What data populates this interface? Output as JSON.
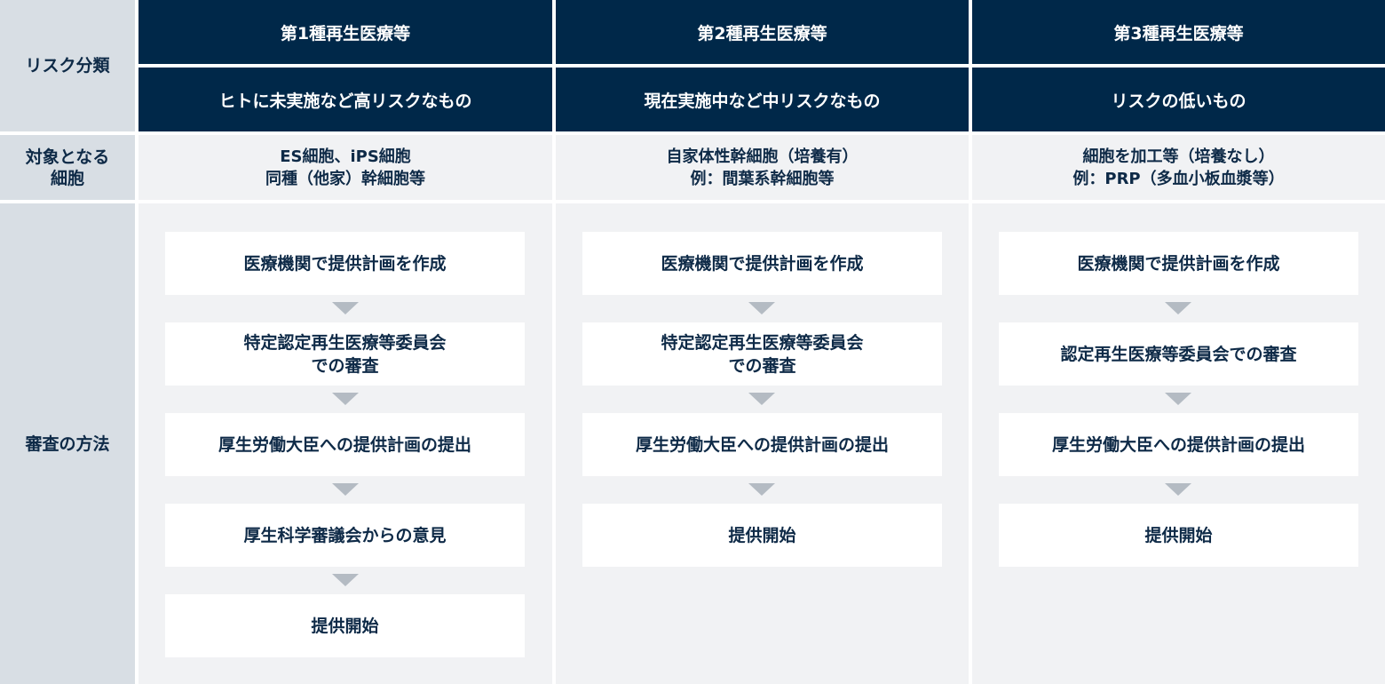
{
  "row_headers": {
    "risk": "リスク分類",
    "cells": "対象となる\n細胞",
    "review": "審査の方法"
  },
  "columns": [
    {
      "title": "第1種再生医療等",
      "risk_desc": "ヒトに未実施など高リスクなもの",
      "target_cells": "ES細胞、iPS細胞\n同種（他家）幹細胞等",
      "steps": [
        "医療機関で提供計画を作成",
        "特定認定再生医療等委員会\nでの審査",
        "厚生労働大臣への提供計画の提出",
        "厚生科学審議会からの意見",
        "提供開始"
      ]
    },
    {
      "title": "第2種再生医療等",
      "risk_desc": "現在実施中など中リスクなもの",
      "target_cells": "自家体性幹細胞（培養有）\n例：間葉系幹細胞等",
      "steps": [
        "医療機関で提供計画を作成",
        "特定認定再生医療等委員会\nでの審査",
        "厚生労働大臣への提供計画の提出",
        "提供開始"
      ]
    },
    {
      "title": "第3種再生医療等",
      "risk_desc": "リスクの低いもの",
      "target_cells": "細胞を加工等（培養なし）\n例：PRP（多血小板血漿等）",
      "steps": [
        "医療機関で提供計画を作成",
        "認定再生医療等委員会での審査",
        "厚生労働大臣への提供計画の提出",
        "提供開始"
      ]
    }
  ],
  "colors": {
    "navy": "#002849",
    "row_header_bg": "#d8dee4",
    "light_bg": "#f1f2f4",
    "arrow": "#b4bbc3",
    "text": "#0e2a47"
  },
  "icons": {
    "step_arrow": "down-triangle-icon"
  }
}
